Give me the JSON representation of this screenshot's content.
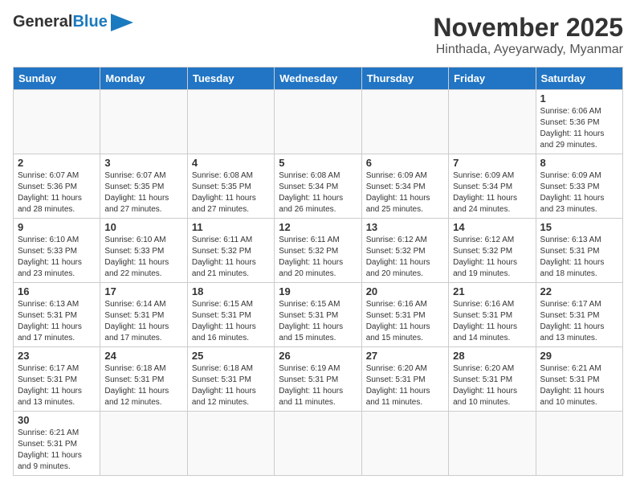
{
  "header": {
    "logo_general": "General",
    "logo_blue": "Blue",
    "month_title": "November 2025",
    "subtitle": "Hinthada, Ayeyarwady, Myanmar"
  },
  "weekdays": [
    "Sunday",
    "Monday",
    "Tuesday",
    "Wednesday",
    "Thursday",
    "Friday",
    "Saturday"
  ],
  "weeks": [
    [
      {
        "day": "",
        "info": ""
      },
      {
        "day": "",
        "info": ""
      },
      {
        "day": "",
        "info": ""
      },
      {
        "day": "",
        "info": ""
      },
      {
        "day": "",
        "info": ""
      },
      {
        "day": "",
        "info": ""
      },
      {
        "day": "1",
        "info": "Sunrise: 6:06 AM\nSunset: 5:36 PM\nDaylight: 11 hours\nand 29 minutes."
      }
    ],
    [
      {
        "day": "2",
        "info": "Sunrise: 6:07 AM\nSunset: 5:36 PM\nDaylight: 11 hours\nand 28 minutes."
      },
      {
        "day": "3",
        "info": "Sunrise: 6:07 AM\nSunset: 5:35 PM\nDaylight: 11 hours\nand 27 minutes."
      },
      {
        "day": "4",
        "info": "Sunrise: 6:08 AM\nSunset: 5:35 PM\nDaylight: 11 hours\nand 27 minutes."
      },
      {
        "day": "5",
        "info": "Sunrise: 6:08 AM\nSunset: 5:34 PM\nDaylight: 11 hours\nand 26 minutes."
      },
      {
        "day": "6",
        "info": "Sunrise: 6:09 AM\nSunset: 5:34 PM\nDaylight: 11 hours\nand 25 minutes."
      },
      {
        "day": "7",
        "info": "Sunrise: 6:09 AM\nSunset: 5:34 PM\nDaylight: 11 hours\nand 24 minutes."
      },
      {
        "day": "8",
        "info": "Sunrise: 6:09 AM\nSunset: 5:33 PM\nDaylight: 11 hours\nand 23 minutes."
      }
    ],
    [
      {
        "day": "9",
        "info": "Sunrise: 6:10 AM\nSunset: 5:33 PM\nDaylight: 11 hours\nand 23 minutes."
      },
      {
        "day": "10",
        "info": "Sunrise: 6:10 AM\nSunset: 5:33 PM\nDaylight: 11 hours\nand 22 minutes."
      },
      {
        "day": "11",
        "info": "Sunrise: 6:11 AM\nSunset: 5:32 PM\nDaylight: 11 hours\nand 21 minutes."
      },
      {
        "day": "12",
        "info": "Sunrise: 6:11 AM\nSunset: 5:32 PM\nDaylight: 11 hours\nand 20 minutes."
      },
      {
        "day": "13",
        "info": "Sunrise: 6:12 AM\nSunset: 5:32 PM\nDaylight: 11 hours\nand 20 minutes."
      },
      {
        "day": "14",
        "info": "Sunrise: 6:12 AM\nSunset: 5:32 PM\nDaylight: 11 hours\nand 19 minutes."
      },
      {
        "day": "15",
        "info": "Sunrise: 6:13 AM\nSunset: 5:31 PM\nDaylight: 11 hours\nand 18 minutes."
      }
    ],
    [
      {
        "day": "16",
        "info": "Sunrise: 6:13 AM\nSunset: 5:31 PM\nDaylight: 11 hours\nand 17 minutes."
      },
      {
        "day": "17",
        "info": "Sunrise: 6:14 AM\nSunset: 5:31 PM\nDaylight: 11 hours\nand 17 minutes."
      },
      {
        "day": "18",
        "info": "Sunrise: 6:15 AM\nSunset: 5:31 PM\nDaylight: 11 hours\nand 16 minutes."
      },
      {
        "day": "19",
        "info": "Sunrise: 6:15 AM\nSunset: 5:31 PM\nDaylight: 11 hours\nand 15 minutes."
      },
      {
        "day": "20",
        "info": "Sunrise: 6:16 AM\nSunset: 5:31 PM\nDaylight: 11 hours\nand 15 minutes."
      },
      {
        "day": "21",
        "info": "Sunrise: 6:16 AM\nSunset: 5:31 PM\nDaylight: 11 hours\nand 14 minutes."
      },
      {
        "day": "22",
        "info": "Sunrise: 6:17 AM\nSunset: 5:31 PM\nDaylight: 11 hours\nand 13 minutes."
      }
    ],
    [
      {
        "day": "23",
        "info": "Sunrise: 6:17 AM\nSunset: 5:31 PM\nDaylight: 11 hours\nand 13 minutes."
      },
      {
        "day": "24",
        "info": "Sunrise: 6:18 AM\nSunset: 5:31 PM\nDaylight: 11 hours\nand 12 minutes."
      },
      {
        "day": "25",
        "info": "Sunrise: 6:18 AM\nSunset: 5:31 PM\nDaylight: 11 hours\nand 12 minutes."
      },
      {
        "day": "26",
        "info": "Sunrise: 6:19 AM\nSunset: 5:31 PM\nDaylight: 11 hours\nand 11 minutes."
      },
      {
        "day": "27",
        "info": "Sunrise: 6:20 AM\nSunset: 5:31 PM\nDaylight: 11 hours\nand 11 minutes."
      },
      {
        "day": "28",
        "info": "Sunrise: 6:20 AM\nSunset: 5:31 PM\nDaylight: 11 hours\nand 10 minutes."
      },
      {
        "day": "29",
        "info": "Sunrise: 6:21 AM\nSunset: 5:31 PM\nDaylight: 11 hours\nand 10 minutes."
      }
    ],
    [
      {
        "day": "30",
        "info": "Sunrise: 6:21 AM\nSunset: 5:31 PM\nDaylight: 11 hours\nand 9 minutes."
      },
      {
        "day": "",
        "info": ""
      },
      {
        "day": "",
        "info": ""
      },
      {
        "day": "",
        "info": ""
      },
      {
        "day": "",
        "info": ""
      },
      {
        "day": "",
        "info": ""
      },
      {
        "day": "",
        "info": ""
      }
    ]
  ]
}
